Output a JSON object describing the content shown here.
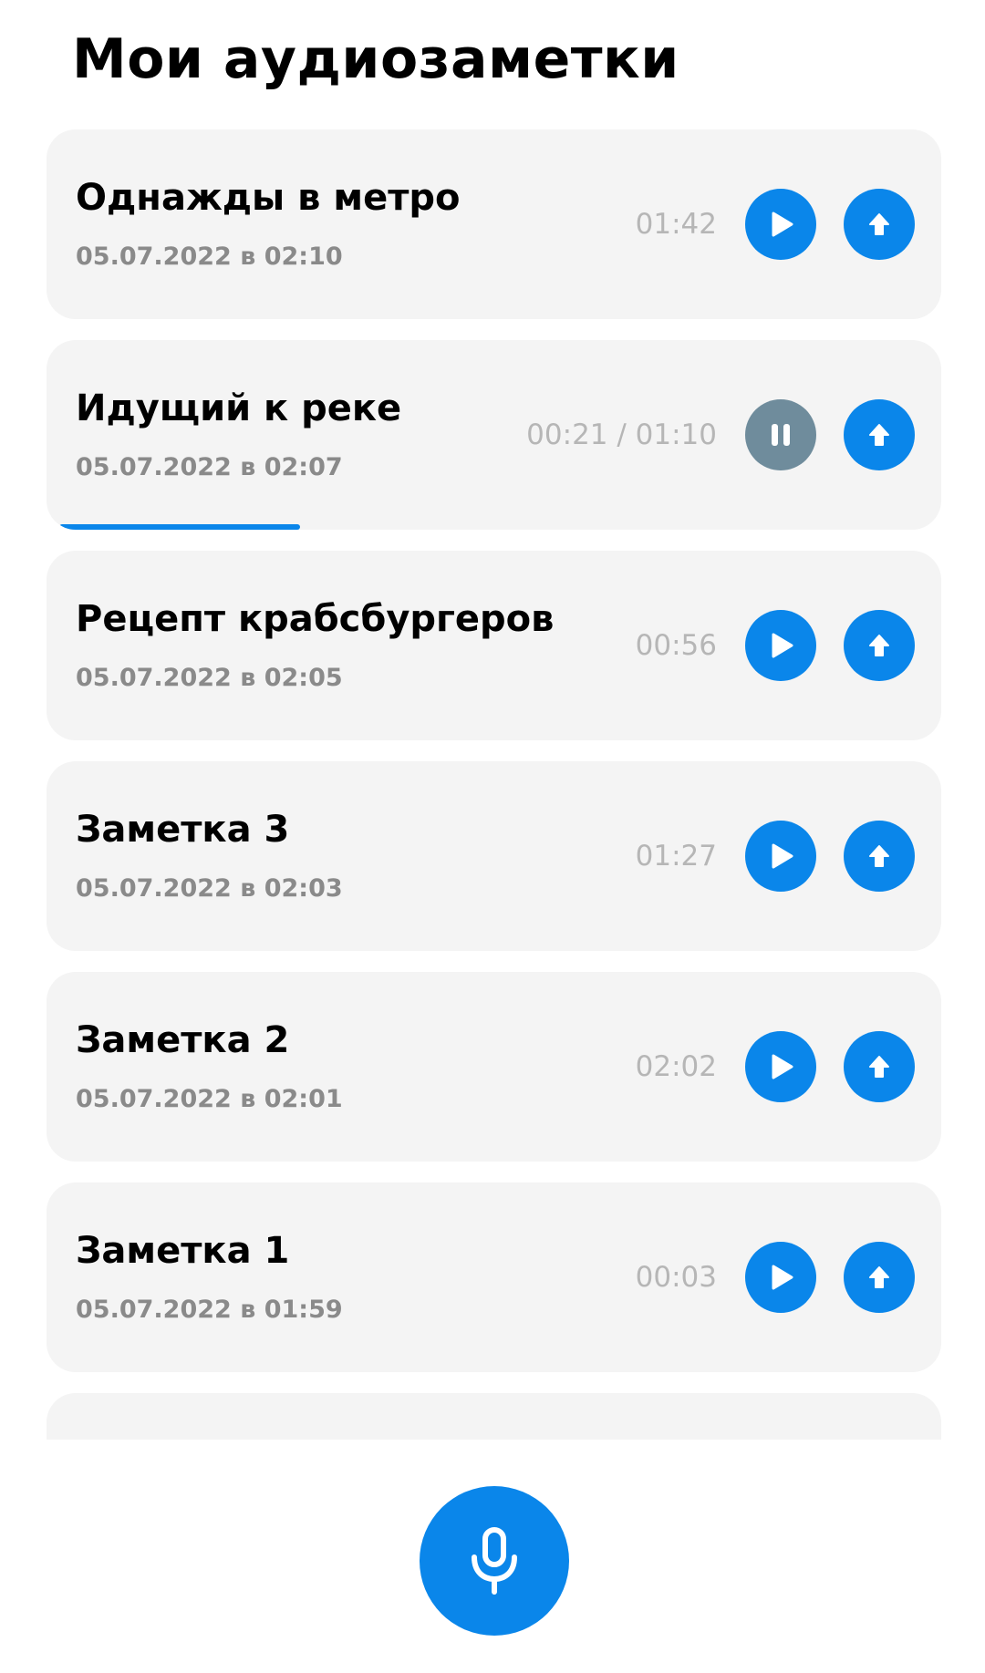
{
  "header": {
    "title": "Мои аудиозаметки"
  },
  "notes": [
    {
      "title": "Однажды в метро",
      "date": "05.07.2022 в 02:10",
      "duration": "01:42",
      "state": "stopped",
      "play_icon": "play-icon",
      "upload_icon": "upload-arrow-icon"
    },
    {
      "title": "Идущий к реке",
      "date": "05.07.2022 в 02:07",
      "duration": "00:21 / 01:10",
      "state": "playing",
      "progress": 0.29,
      "play_icon": "pause-icon",
      "upload_icon": "upload-arrow-icon"
    },
    {
      "title": "Рецепт крабсбургеров",
      "date": "05.07.2022 в 02:05",
      "duration": "00:56",
      "state": "stopped",
      "play_icon": "play-icon",
      "upload_icon": "upload-arrow-icon"
    },
    {
      "title": "Заметка 3",
      "date": "05.07.2022 в 02:03",
      "duration": "01:27",
      "state": "stopped",
      "play_icon": "play-icon",
      "upload_icon": "upload-arrow-icon"
    },
    {
      "title": "Заметка 2",
      "date": "05.07.2022 в 02:01",
      "duration": "02:02",
      "state": "stopped",
      "play_icon": "play-icon",
      "upload_icon": "upload-arrow-icon"
    },
    {
      "title": "Заметка 1",
      "date": "05.07.2022 в 01:59",
      "duration": "00:03",
      "state": "stopped",
      "play_icon": "play-icon",
      "upload_icon": "upload-arrow-icon"
    }
  ],
  "record_button": {
    "icon": "microphone-icon"
  },
  "colors": {
    "accent": "#0a86ea",
    "paused_button": "#6f8c9c",
    "card_background": "#f4f4f4",
    "date_text": "#8a8a8a",
    "duration_text": "#b6b6b6"
  }
}
